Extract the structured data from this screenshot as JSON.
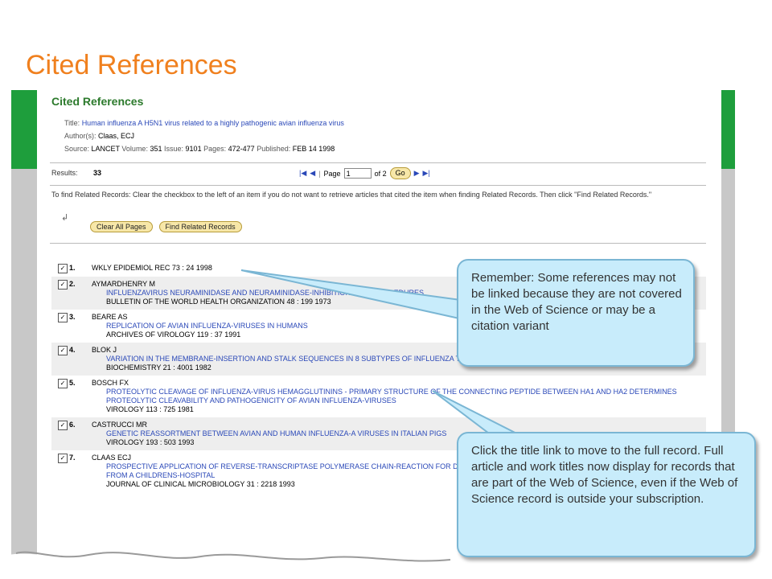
{
  "slide": {
    "title": "Cited References"
  },
  "header": {
    "title": "Cited References",
    "title_label": "Title:",
    "title_value": "Human influenza A H5N1 virus related to a highly pathogenic avian influenza virus",
    "authors_label": "Author(s):",
    "authors_value": "Claas, ECJ",
    "source_label": "Source:",
    "source_journal": "LANCET",
    "volume_label": "Volume:",
    "volume_value": "351",
    "issue_label": "Issue:",
    "issue_value": "9101",
    "pages_label": "Pages:",
    "pages_value": "472-477",
    "published_label": "Published:",
    "published_value": "FEB 14 1998"
  },
  "results": {
    "label": "Results:",
    "count": "33",
    "page_label": "Page",
    "page_value": "1",
    "of_label": "of 2",
    "go_label": "Go"
  },
  "instructions": "To find Related Records: Clear the checkbox to the left of an item if you do not want to retrieve articles that cited the item when finding Related Records. Then click \"Find Related Records.\"",
  "buttons": {
    "clear_all": "Clear All Pages",
    "find_related": "Find Related Records"
  },
  "references": [
    {
      "num": "1.",
      "author": "WKLY EPIDEMIOL REC 73 : 24 1998",
      "title": "",
      "source": ""
    },
    {
      "num": "2.",
      "author": "AYMARDHENRY M",
      "title": "INFLUENZAVIRUS NEURAMINIDASE AND NEURAMINIDASE-INHIBITION TEST PROCEDURES",
      "source": "BULLETIN OF THE WORLD HEALTH ORGANIZATION 48 : 199 1973"
    },
    {
      "num": "3.",
      "author": "BEARE AS",
      "title": "REPLICATION OF AVIAN INFLUENZA-VIRUSES IN HUMANS",
      "source": "ARCHIVES OF VIROLOGY 119 : 37 1991"
    },
    {
      "num": "4.",
      "author": "BLOK J",
      "title": "VARIATION IN THE MEMBRANE-INSERTION AND STALK SEQUENCES IN 8 SUBTYPES OF INFLUENZA TYPE-A VIRUS NEURAMINIDASE",
      "source": "BIOCHEMISTRY 21 : 4001 1982"
    },
    {
      "num": "5.",
      "author": "BOSCH FX",
      "title": "PROTEOLYTIC CLEAVAGE OF INFLUENZA-VIRUS HEMAGGLUTININS - PRIMARY STRUCTURE OF THE CONNECTING PEPTIDE BETWEEN HA1 AND HA2 DETERMINES PROTEOLYTIC CLEAVABILITY AND PATHOGENICITY OF AVIAN INFLUENZA-VIRUSES",
      "source": "VIROLOGY 113 : 725 1981"
    },
    {
      "num": "6.",
      "author": "CASTRUCCI MR",
      "title": "GENETIC REASSORTMENT BETWEEN AVIAN AND HUMAN INFLUENZA-A VIRUSES IN ITALIAN PIGS",
      "source": "VIROLOGY 193 : 503 1993"
    },
    {
      "num": "7.",
      "author": "CLAAS ECJ",
      "title": "PROSPECTIVE APPLICATION OF REVERSE-TRANSCRIPTASE POLYMERASE CHAIN-REACTION FOR DIAGNOSING INFLUENZA-INFECTIONS IN RESPIRATORY SAMPLES FROM A CHILDRENS-HOSPITAL",
      "source": "JOURNAL OF CLINICAL MICROBIOLOGY 31 : 2218 1993"
    }
  ],
  "callouts": {
    "first": "Remember: Some references may not be linked because they are not covered in the Web of Science or may be a citation variant",
    "second": "Click the title link to move to the full record. Full article and work titles now display for records that are part of the Web of Science, even if the Web of Science record is outside your subscription."
  },
  "colors": {
    "slide_title": "#f0801e",
    "header_green": "#2c7a2c",
    "side_bar_green": "#1e9e3c",
    "link_blue": "#2a48b8",
    "callout_fill": "#c8ecfb",
    "callout_border": "#7ab6d4"
  }
}
